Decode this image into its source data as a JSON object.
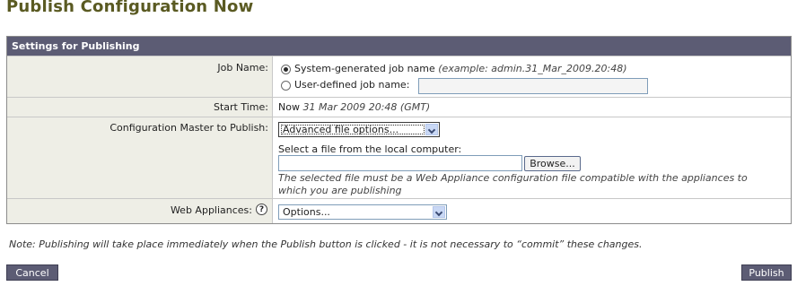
{
  "page": {
    "title": "Publish Configuration Now"
  },
  "panel": {
    "header": "Settings for Publishing"
  },
  "job_name": {
    "label": "Job Name:",
    "option_system": "System-generated job name",
    "system_example": "(example: admin.31_Mar_2009.20:48)",
    "option_user": "User-defined job name:",
    "user_value": "",
    "selected": "system"
  },
  "start_time": {
    "label": "Start Time:",
    "prefix": "Now",
    "value": "31 Mar 2009 20:48 (GMT)"
  },
  "config_master": {
    "label": "Configuration Master to Publish:",
    "selected": "Advanced file options...",
    "file_prompt": "Select a file from the local computer:",
    "file_value": "",
    "browse_label": "Browse...",
    "hint_line1": "The selected file must be a Web Appliance configuration file compatible with the appliances to",
    "hint_line2": "which you are publishing"
  },
  "web_appliances": {
    "label": "Web Appliances:",
    "help_glyph": "?",
    "selected": "Options..."
  },
  "note": "Note: Publishing will take place immediately when the Publish button is clicked - it is not necessary to “commit” these changes.",
  "buttons": {
    "cancel": "Cancel",
    "publish": "Publish"
  },
  "colors": {
    "title": "#5a5a22",
    "header_bg": "#5c5c74",
    "label_bg": "#eeeee6",
    "button_bg": "#5c5c74"
  }
}
